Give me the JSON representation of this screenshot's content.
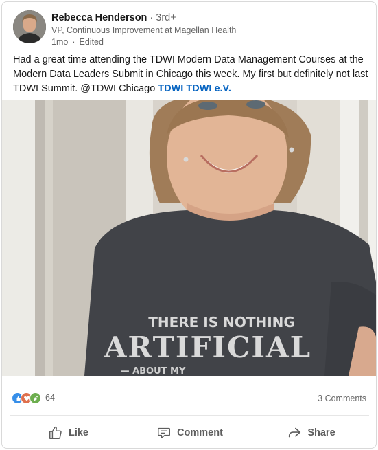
{
  "post": {
    "author": {
      "name": "Rebecca Henderson",
      "separator": "·",
      "degree": "3rd+",
      "headline": "VP, Continuous Improvement at Magellan Health",
      "time": "1mo",
      "time_separator": "·",
      "edited": "Edited"
    },
    "text": {
      "body": "Had a great time attending the TDWI Modern Data Management Courses at the Modern Data Leaders Submit in Chicago this week.  My first but definitely not last TDWI Summit. @TDWI Chicago ",
      "mention": "TDWI TDWI e.V."
    },
    "image": {
      "shirt_line1": "THERE IS NOTHING",
      "shirt_line2": "ARTIFICIAL",
      "shirt_line3": "— ABOUT MY"
    },
    "social": {
      "reaction_icons": [
        "like-icon",
        "love-icon",
        "celebrate-icon"
      ],
      "reaction_count": "64",
      "comments": "3 Comments"
    },
    "actions": {
      "like": "Like",
      "comment": "Comment",
      "share": "Share"
    }
  },
  "colors": {
    "link": "#0a66c2",
    "like": "#378fe9",
    "love": "#df704d",
    "celebrate": "#6dae4f"
  }
}
